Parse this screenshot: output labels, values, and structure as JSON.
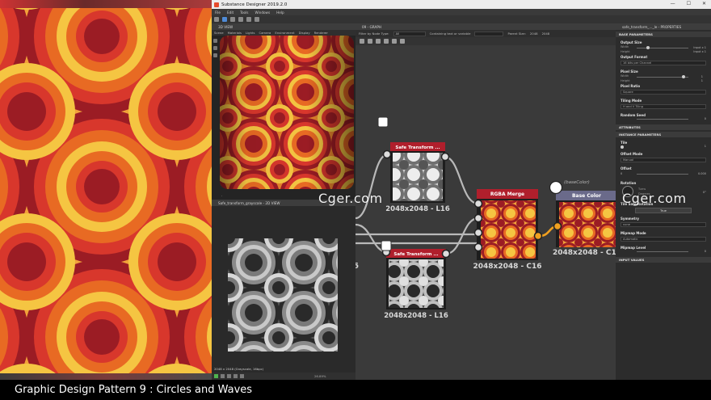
{
  "app": {
    "title": "Substance Designer 2019.2.0",
    "window_controls": [
      "—",
      "☐",
      "✕"
    ],
    "menu": [
      "File",
      "Edit",
      "Tools",
      "Windows",
      "Help"
    ]
  },
  "view3d": {
    "title": "3D VIEW",
    "menu": [
      "Scene",
      "Materials",
      "Lights",
      "Camera",
      "Environment",
      "Display",
      "Renderer"
    ]
  },
  "view2d": {
    "title": "Safe_transform_grayscale - 2D VIEW",
    "status": "2048 x 2048 (Grayscale, 16bpc)",
    "zoom": "26.89%"
  },
  "graph": {
    "title": "09 - GRAPH",
    "filter_label": "Filter by Node Type:",
    "filter_value": "All",
    "search_label": "Containing text or variable",
    "parent_size_label": "Parent Size:",
    "parent_size_value": "2048",
    "size_value": "2048",
    "nodes": [
      {
        "title": "Safe Transform ...",
        "size": "2048x2048 - L16"
      },
      {
        "title": "Safe Transform ...",
        "size": "2048x2048 - L16"
      },
      {
        "title": "RGBA Merge",
        "size": "2048x2048 - C16"
      },
      {
        "title": "Base Color",
        "size": "2048x2048 - C1",
        "tag": "(baseColor)"
      }
    ],
    "partial_label": "6"
  },
  "props": {
    "title": "safe_transform_..._le - PROPERTIES",
    "sections": {
      "base": "BASE PARAMETERS",
      "attributes": "ATTRIBUTES",
      "instance": "INSTANCE PARAMETERS",
      "input_values": "INPUT VALUES"
    },
    "output_size": {
      "label": "Output Size",
      "width": "Width",
      "height": "Height",
      "w_val": "Input x 1",
      "h_val": "Input x 1"
    },
    "output_format": {
      "label": "Output Format",
      "value": "16 bits per Channel"
    },
    "pixel_size": {
      "label": "Pixel Size",
      "width": "Width",
      "height": "Height",
      "w_val": "1",
      "h_val": "1"
    },
    "pixel_ratio": {
      "label": "Pixel Ratio",
      "value": "Square"
    },
    "tiling_mode": {
      "label": "Tiling Mode",
      "value": "H and V Tiling"
    },
    "random_seed": {
      "label": "Random Seed",
      "value": "0"
    },
    "tile": {
      "label": "Tile",
      "value": "1"
    },
    "offset_mode": {
      "label": "Offset Mode",
      "value": "Manual"
    },
    "offset": {
      "label": "Offset",
      "x": "0",
      "y": "0.000"
    },
    "rotation": {
      "label": "Rotation",
      "value": "0°",
      "turns": "Turns",
      "degrees": "Degrees"
    },
    "tile_safe_rotation": {
      "label": "Tile Safe Rotation",
      "value": "True"
    },
    "symmetry": {
      "label": "Symmetry",
      "value": "none"
    },
    "mipmap_mode": {
      "label": "Mipmap Mode",
      "value": "Automatic"
    },
    "mipmap_level": {
      "label": "Mipmap Level",
      "value": "0"
    }
  },
  "watermarks": [
    "Cger.com",
    "Cger.com"
  ],
  "caption": "Graphic Design Pattern 9 : Circles and Waves",
  "colors": {
    "pattern_bg": "#f2a23a",
    "pattern_ring_dark": "#9b1c24",
    "pattern_ring_red": "#d8372c",
    "pattern_ring_orange": "#e86a23",
    "pattern_ring_yellow": "#f5c542",
    "node_header_red": "#b01f2c",
    "node_header_base": "#6a6a8a",
    "wire": "#b9b9b9",
    "wire_orange": "#f0a020"
  }
}
